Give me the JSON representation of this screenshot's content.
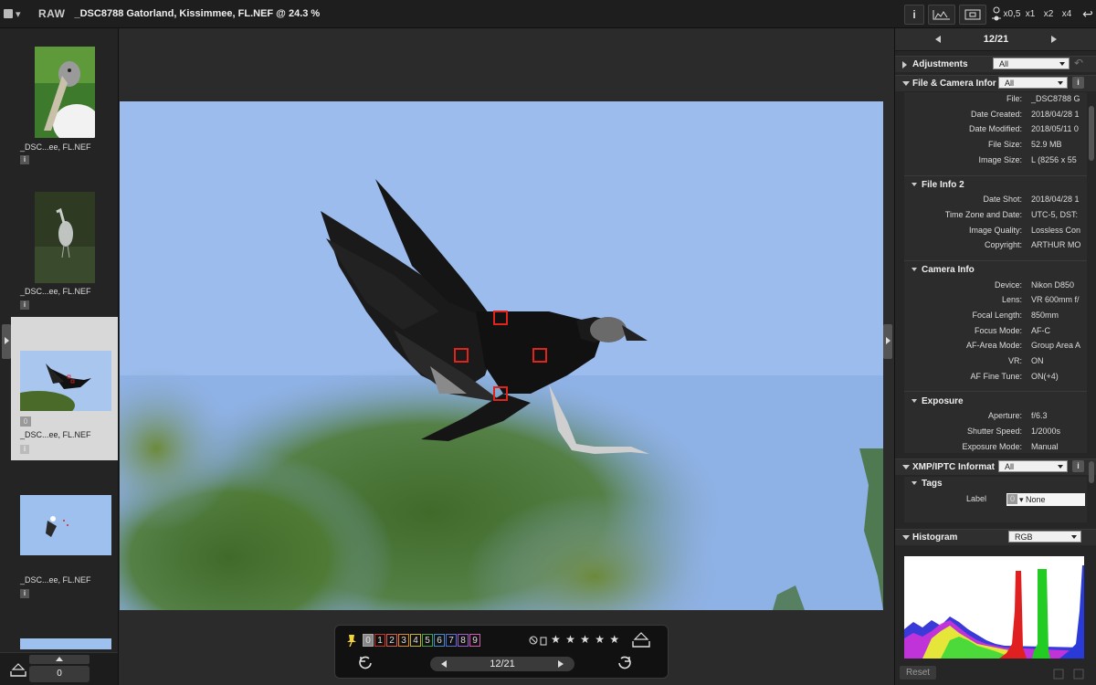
{
  "app": {
    "mode": "RAW",
    "title": "_DSC8788 Gatorland, Kissimmee, FL.NEF @ 24.3 %"
  },
  "zoom": {
    "levels": [
      "x0,5",
      "x1",
      "x2",
      "x4"
    ],
    "info_button": "i"
  },
  "filmstrip": {
    "items": [
      {
        "name": "_DSC...ee, FL.NEF",
        "kind": "stork"
      },
      {
        "name": "_DSC...ee, FL.NEF",
        "kind": "heron"
      },
      {
        "name": "_DSC...ee, FL.NEF",
        "kind": "vulture",
        "label": "0",
        "selected": true
      },
      {
        "name": "_DSC...ee, FL.NEF",
        "kind": "eagle"
      }
    ],
    "count": "0"
  },
  "viewer_toolbar": {
    "labels": [
      "0",
      "1",
      "2",
      "3",
      "4",
      "5",
      "6",
      "7",
      "8",
      "9"
    ],
    "label_colors": [
      "#aaaaaa",
      "#c0392b",
      "#e05a4a",
      "#d98b2b",
      "#c8b52a",
      "#4aa04a",
      "#3a8fd0",
      "#5b6fd0",
      "#a05bd0",
      "#d05bb0"
    ],
    "stars": "★ ★ ★ ★ ★",
    "page": "12/21"
  },
  "panel": {
    "page": "12/21",
    "adjustments": {
      "title": "Adjustments",
      "filter": "All"
    },
    "file_camera": {
      "title": "File & Camera Infor",
      "filter": "All"
    },
    "file_info_1": [
      {
        "k": "File:",
        "v": "_DSC8788 G"
      },
      {
        "k": "Date Created:",
        "v": "2018/04/28 1"
      },
      {
        "k": "Date Modified:",
        "v": "2018/05/11 0"
      },
      {
        "k": "File Size:",
        "v": "52.9 MB"
      },
      {
        "k": "Image Size:",
        "v": "L (8256 x 55"
      }
    ],
    "file_info_2": {
      "title": "File Info 2",
      "rows": [
        {
          "k": "Date Shot:",
          "v": "2018/04/28 1"
        },
        {
          "k": "Time Zone and Date:",
          "v": "UTC-5, DST:"
        },
        {
          "k": "Image Quality:",
          "v": "Lossless Con"
        },
        {
          "k": "Copyright:",
          "v": "ARTHUR MO"
        }
      ]
    },
    "camera_info": {
      "title": "Camera Info",
      "rows": [
        {
          "k": "Device:",
          "v": "Nikon D850"
        },
        {
          "k": "Lens:",
          "v": "VR 600mm f/"
        },
        {
          "k": "Focal Length:",
          "v": "850mm"
        },
        {
          "k": "Focus Mode:",
          "v": "AF-C"
        },
        {
          "k": "AF-Area Mode:",
          "v": "Group Area A"
        },
        {
          "k": "VR:",
          "v": "ON"
        },
        {
          "k": "AF Fine Tune:",
          "v": "ON(+4)"
        }
      ]
    },
    "exposure": {
      "title": "Exposure",
      "rows": [
        {
          "k": "Aperture:",
          "v": "f/6.3"
        },
        {
          "k": "Shutter Speed:",
          "v": "1/2000s"
        },
        {
          "k": "Exposure Mode:",
          "v": "Manual"
        }
      ]
    },
    "xmp": {
      "title": "XMP/IPTC Informat",
      "filter": "All"
    },
    "tags": {
      "title": "Tags",
      "label_key": "Label",
      "label_num": "0",
      "label_value": "None"
    },
    "histogram": {
      "title": "Histogram",
      "channel": "RGB"
    },
    "reset": "Reset"
  }
}
